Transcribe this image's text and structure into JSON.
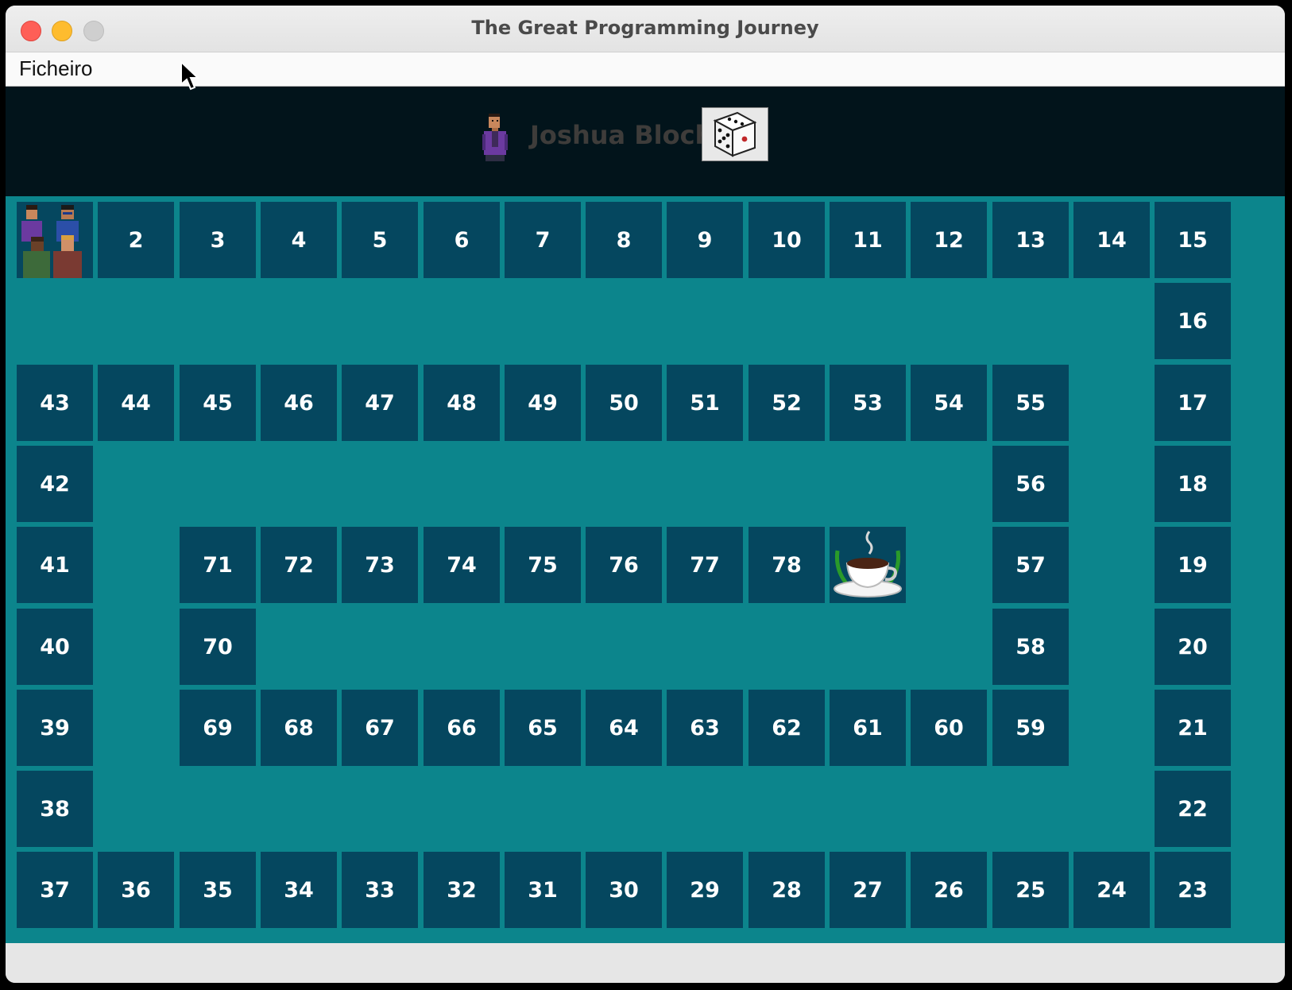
{
  "window": {
    "title": "The Great Programming Journey"
  },
  "menu": {
    "file_label": "Ficheiro"
  },
  "header": {
    "current_player": "Joshua Bloch",
    "dice_icon": "dice-icon",
    "name_color": "#3e3c3a"
  },
  "board": {
    "start_cell_content": "players-group-icon",
    "finish_cell_content": "coffee-cup-icon",
    "cells": [
      {
        "label": "",
        "row": 0,
        "col": 0,
        "special": "start"
      },
      {
        "label": "2",
        "row": 0,
        "col": 1
      },
      {
        "label": "3",
        "row": 0,
        "col": 2
      },
      {
        "label": "4",
        "row": 0,
        "col": 3
      },
      {
        "label": "5",
        "row": 0,
        "col": 4
      },
      {
        "label": "6",
        "row": 0,
        "col": 5
      },
      {
        "label": "7",
        "row": 0,
        "col": 6
      },
      {
        "label": "8",
        "row": 0,
        "col": 7
      },
      {
        "label": "9",
        "row": 0,
        "col": 8
      },
      {
        "label": "10",
        "row": 0,
        "col": 9
      },
      {
        "label": "11",
        "row": 0,
        "col": 10
      },
      {
        "label": "12",
        "row": 0,
        "col": 11
      },
      {
        "label": "13",
        "row": 0,
        "col": 12
      },
      {
        "label": "14",
        "row": 0,
        "col": 13
      },
      {
        "label": "15",
        "row": 0,
        "col": 14
      },
      {
        "label": "16",
        "row": 1,
        "col": 14
      },
      {
        "label": "17",
        "row": 2,
        "col": 14
      },
      {
        "label": "18",
        "row": 3,
        "col": 14
      },
      {
        "label": "19",
        "row": 4,
        "col": 14
      },
      {
        "label": "20",
        "row": 5,
        "col": 14
      },
      {
        "label": "21",
        "row": 6,
        "col": 14
      },
      {
        "label": "22",
        "row": 7,
        "col": 14
      },
      {
        "label": "23",
        "row": 8,
        "col": 14
      },
      {
        "label": "24",
        "row": 8,
        "col": 13
      },
      {
        "label": "25",
        "row": 8,
        "col": 12
      },
      {
        "label": "26",
        "row": 8,
        "col": 11
      },
      {
        "label": "27",
        "row": 8,
        "col": 10
      },
      {
        "label": "28",
        "row": 8,
        "col": 9
      },
      {
        "label": "29",
        "row": 8,
        "col": 8
      },
      {
        "label": "30",
        "row": 8,
        "col": 7
      },
      {
        "label": "31",
        "row": 8,
        "col": 6
      },
      {
        "label": "32",
        "row": 8,
        "col": 5
      },
      {
        "label": "33",
        "row": 8,
        "col": 4
      },
      {
        "label": "34",
        "row": 8,
        "col": 3
      },
      {
        "label": "35",
        "row": 8,
        "col": 2
      },
      {
        "label": "36",
        "row": 8,
        "col": 1
      },
      {
        "label": "37",
        "row": 8,
        "col": 0
      },
      {
        "label": "38",
        "row": 7,
        "col": 0
      },
      {
        "label": "39",
        "row": 6,
        "col": 0
      },
      {
        "label": "40",
        "row": 5,
        "col": 0
      },
      {
        "label": "41",
        "row": 4,
        "col": 0
      },
      {
        "label": "42",
        "row": 3,
        "col": 0
      },
      {
        "label": "43",
        "row": 2,
        "col": 0
      },
      {
        "label": "44",
        "row": 2,
        "col": 1
      },
      {
        "label": "45",
        "row": 2,
        "col": 2
      },
      {
        "label": "46",
        "row": 2,
        "col": 3
      },
      {
        "label": "47",
        "row": 2,
        "col": 4
      },
      {
        "label": "48",
        "row": 2,
        "col": 5
      },
      {
        "label": "49",
        "row": 2,
        "col": 6
      },
      {
        "label": "50",
        "row": 2,
        "col": 7
      },
      {
        "label": "51",
        "row": 2,
        "col": 8
      },
      {
        "label": "52",
        "row": 2,
        "col": 9
      },
      {
        "label": "53",
        "row": 2,
        "col": 10
      },
      {
        "label": "54",
        "row": 2,
        "col": 11
      },
      {
        "label": "55",
        "row": 2,
        "col": 12
      },
      {
        "label": "56",
        "row": 3,
        "col": 12
      },
      {
        "label": "57",
        "row": 4,
        "col": 12
      },
      {
        "label": "58",
        "row": 5,
        "col": 12
      },
      {
        "label": "59",
        "row": 6,
        "col": 12
      },
      {
        "label": "60",
        "row": 6,
        "col": 11
      },
      {
        "label": "61",
        "row": 6,
        "col": 10
      },
      {
        "label": "62",
        "row": 6,
        "col": 9
      },
      {
        "label": "63",
        "row": 6,
        "col": 8
      },
      {
        "label": "64",
        "row": 6,
        "col": 7
      },
      {
        "label": "65",
        "row": 6,
        "col": 6
      },
      {
        "label": "66",
        "row": 6,
        "col": 5
      },
      {
        "label": "67",
        "row": 6,
        "col": 4
      },
      {
        "label": "68",
        "row": 6,
        "col": 3
      },
      {
        "label": "69",
        "row": 6,
        "col": 2
      },
      {
        "label": "70",
        "row": 5,
        "col": 2
      },
      {
        "label": "71",
        "row": 4,
        "col": 2
      },
      {
        "label": "72",
        "row": 4,
        "col": 3
      },
      {
        "label": "73",
        "row": 4,
        "col": 4
      },
      {
        "label": "74",
        "row": 4,
        "col": 5
      },
      {
        "label": "75",
        "row": 4,
        "col": 6
      },
      {
        "label": "76",
        "row": 4,
        "col": 7
      },
      {
        "label": "77",
        "row": 4,
        "col": 8
      },
      {
        "label": "78",
        "row": 4,
        "col": 9
      },
      {
        "label": "",
        "row": 4,
        "col": 10,
        "special": "finish"
      }
    ]
  }
}
